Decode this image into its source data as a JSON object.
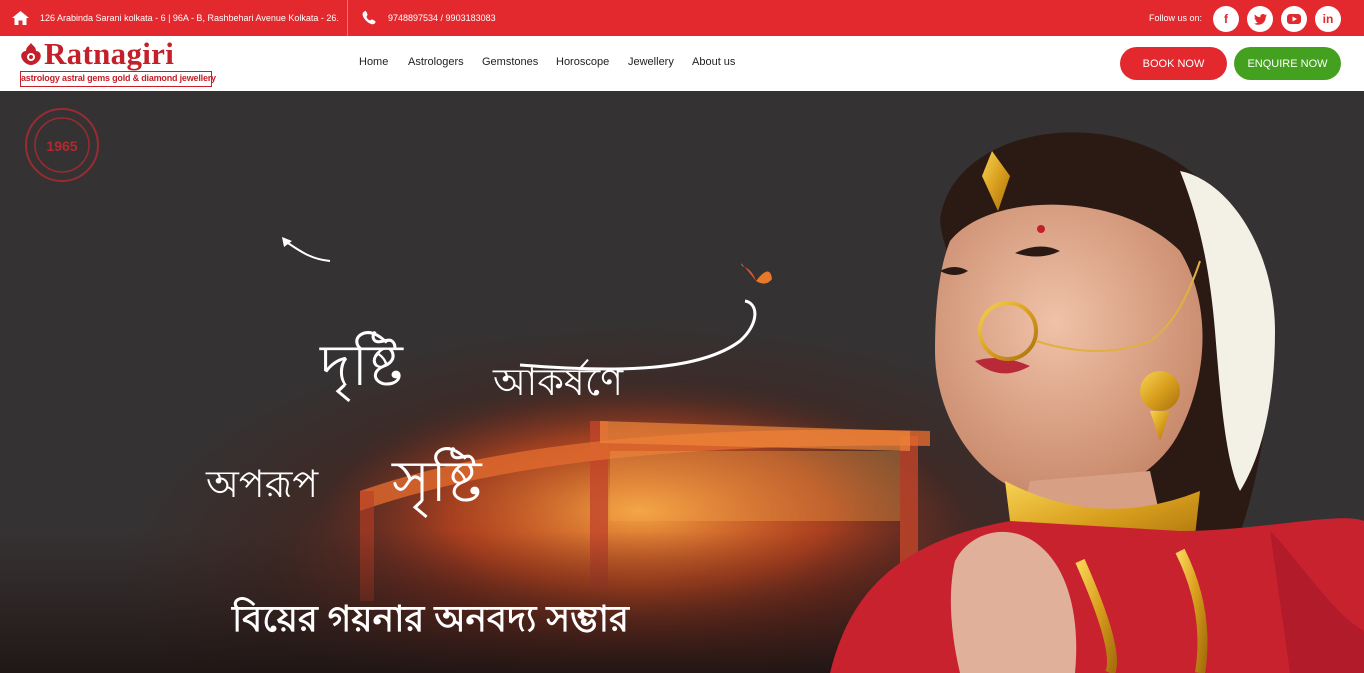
{
  "topbar": {
    "address": "126 Arabinda Sarani kolkata - 6 | 96A - B, Rashbehari Avenue Kolkata - 26.",
    "phone": "9748897534 / 9903183083",
    "follow_label": "Follow us on:",
    "social": [
      {
        "icon": "facebook-icon",
        "glyph": "f"
      },
      {
        "icon": "twitter-icon",
        "glyph": "t"
      },
      {
        "icon": "youtube-icon",
        "glyph": "▶"
      },
      {
        "icon": "linkedin-icon",
        "glyph": "in"
      }
    ]
  },
  "header": {
    "logo_name": "Ratnagiri",
    "logo_tagline": "astrology  astral gems  gold & diamond jewellery",
    "nav": [
      "Home",
      "Astrologers",
      "Gemstones",
      "Horoscope",
      "Jewellery",
      "About us"
    ],
    "book_label": "BOOK NOW",
    "enquire_label": "ENQUIRE NOW"
  },
  "hero": {
    "seal_year": "1965",
    "headline_1a": "দৃষ্টি",
    "headline_1b": "আকর্ষণে",
    "headline_2a": "অপরূপ",
    "headline_2b": "সৃষ্টি",
    "subheadline": "বিয়ের গয়নার অনবদ্য সম্ভার"
  },
  "colors": {
    "brand_red": "#e3292e",
    "enquire_green": "#44a11f",
    "logo_red": "#c4202a"
  }
}
